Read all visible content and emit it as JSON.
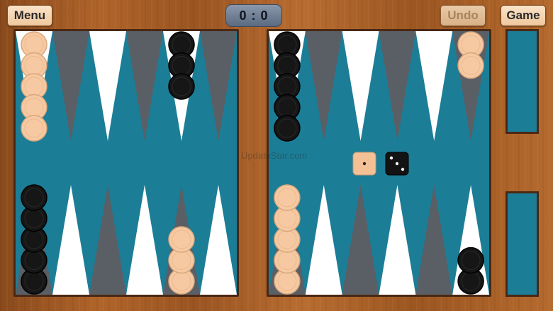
{
  "toolbar": {
    "menu_label": "Menu",
    "undo_label": "Undo",
    "game_label": "Game"
  },
  "score": {
    "text": "0 : 0"
  },
  "colors": {
    "felt": "#1c7d96",
    "point_light": "#ffffff",
    "point_dark": "#5a5f66",
    "checker_light": "#f6c9a2",
    "checker_dark": "#161616",
    "wood": "#a35e26"
  },
  "board": {
    "dice": [
      {
        "owner": "light",
        "value": 1
      },
      {
        "owner": "dark",
        "value": 3
      }
    ],
    "checkers": [
      {
        "point": 1,
        "color": "dark",
        "count": 2
      },
      {
        "point": 6,
        "color": "light",
        "count": 5
      },
      {
        "point": 8,
        "color": "light",
        "count": 3
      },
      {
        "point": 12,
        "color": "dark",
        "count": 5
      },
      {
        "point": 13,
        "color": "light",
        "count": 5
      },
      {
        "point": 17,
        "color": "dark",
        "count": 3
      },
      {
        "point": 19,
        "color": "dark",
        "count": 5
      },
      {
        "point": 24,
        "color": "light",
        "count": 2
      }
    ]
  },
  "watermark": "UpdateStar.com"
}
